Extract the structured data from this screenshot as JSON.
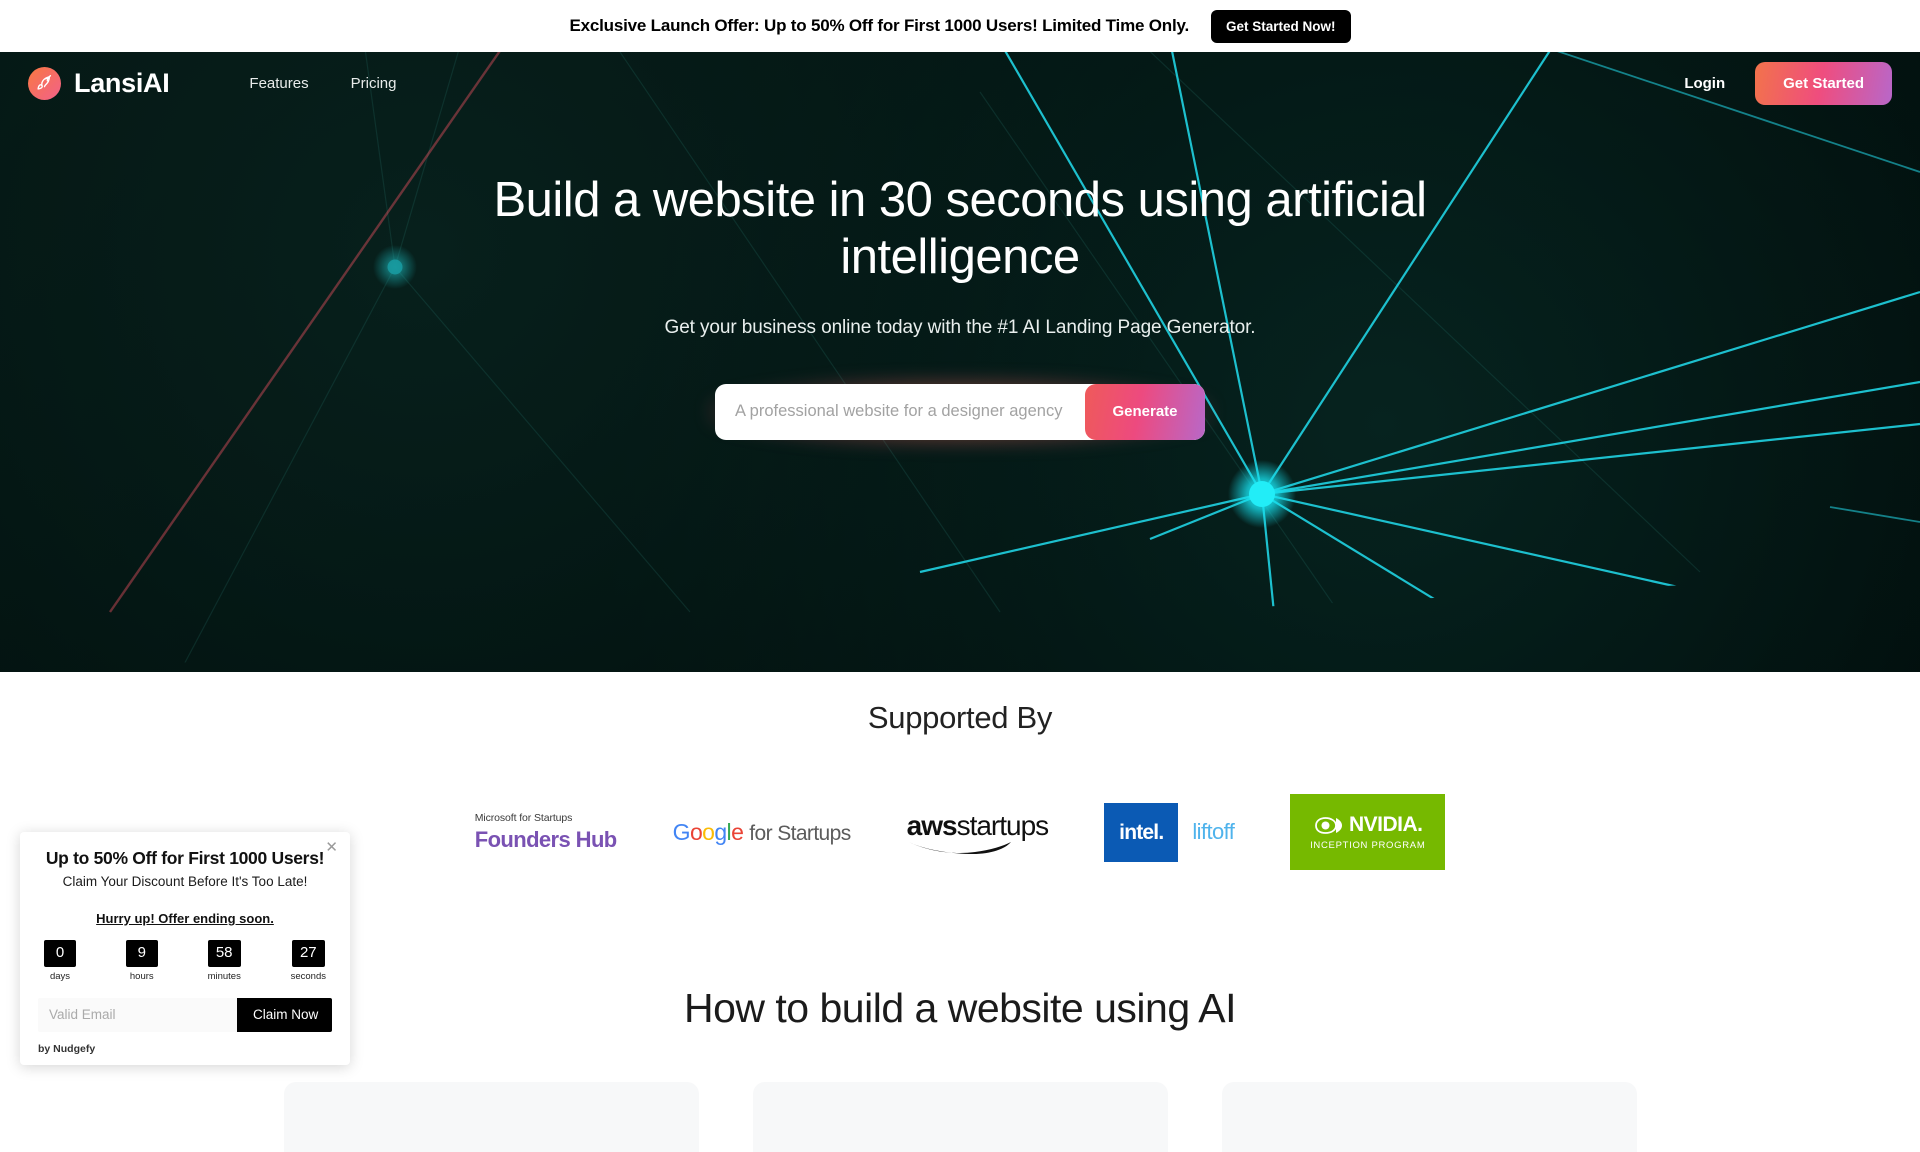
{
  "banner": {
    "text": "Exclusive Launch Offer: Up to 50% Off for First 1000 Users! Limited Time Only.",
    "button_label": "Get Started Now!",
    "bg": "#ffffff",
    "button_bg": "#000000"
  },
  "nav": {
    "logo_icon": "rocket-icon",
    "brand": "LansiAI",
    "links": [
      {
        "label": "Features"
      },
      {
        "label": "Pricing"
      }
    ],
    "login_label": "Login",
    "cta_label": "Get Started",
    "cta_gradient": "#f2734b → #ef4d7e → #b867c9"
  },
  "hero": {
    "title": "Build a website in 30 seconds using artificial intelligence",
    "subtitle": "Get your business online today with the #1 AI Landing Page Generator.",
    "bg_color": "#02100e",
    "accent_node_color": "#17e2f0",
    "generator": {
      "placeholder": "A professional website for a designer agency",
      "value": "",
      "button_label": "Generate"
    }
  },
  "supported": {
    "title": "Supported By",
    "logos": [
      {
        "name": "microsoft-founders-hub",
        "line1": "Microsoft for Startups",
        "line2": "Founders Hub",
        "color": "#7a52b3"
      },
      {
        "name": "google-for-startups",
        "word": "Google",
        "rest": "for Startups",
        "letters": [
          {
            "ch": "G",
            "color": "#4285F4"
          },
          {
            "ch": "o",
            "color": "#EA4335"
          },
          {
            "ch": "o",
            "color": "#FBBC05"
          },
          {
            "ch": "g",
            "color": "#4285F4"
          },
          {
            "ch": "l",
            "color": "#34A853"
          },
          {
            "ch": "e",
            "color": "#EA4335"
          }
        ]
      },
      {
        "name": "aws-startups",
        "line1": "aws",
        "line2": "startups",
        "color": "#101010"
      },
      {
        "name": "intel-liftoff",
        "line1": "intel.",
        "line2": "liftoff",
        "box_color": "#0b5ab4",
        "text_color": "#4fb3ec"
      },
      {
        "name": "nvidia-inception-program",
        "line1": "NVIDIA.",
        "line2": "INCEPTION PROGRAM",
        "box_color": "#76b900"
      }
    ]
  },
  "howto": {
    "title": "How to build a website using AI"
  },
  "popup": {
    "close_icon": "close-icon",
    "heading": "Up to 50% Off for First 1000 Users!",
    "subheading": "Claim Your Discount Before It's Too Late!",
    "urgency": "Hurry up! Offer ending soon.",
    "timer": [
      {
        "value": "0",
        "label": "days"
      },
      {
        "value": "9",
        "label": "hours"
      },
      {
        "value": "58",
        "label": "minutes"
      },
      {
        "value": "27",
        "label": "seconds"
      }
    ],
    "email_placeholder": "Valid Email",
    "email_value": "",
    "claim_label": "Claim Now",
    "credit": "by Nudgefy"
  }
}
